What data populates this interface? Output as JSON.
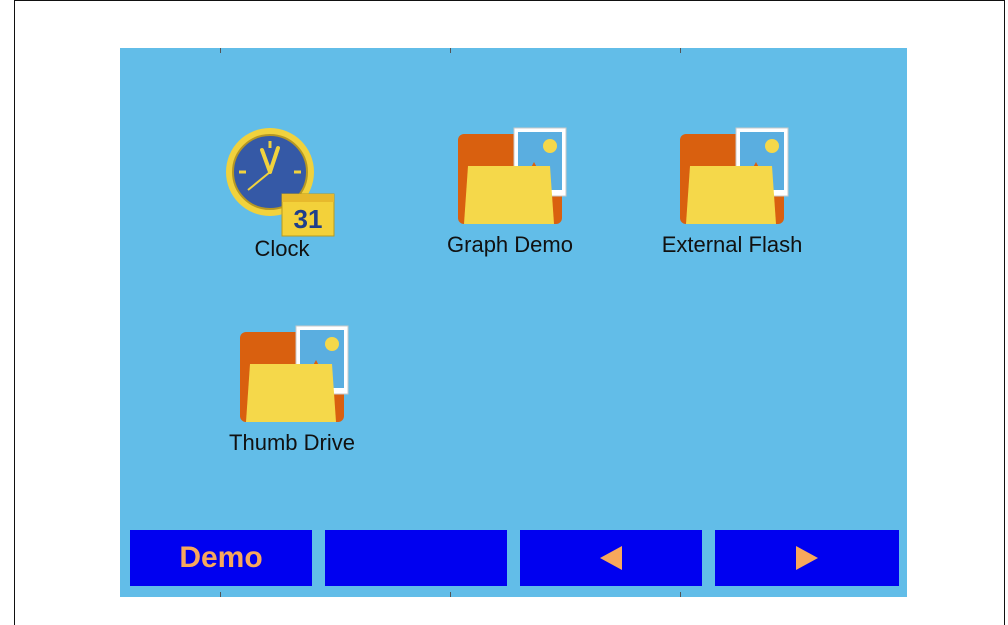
{
  "apps": [
    {
      "label": "Clock",
      "icon": "clock-calendar-icon",
      "badge": "31"
    },
    {
      "label": "Graph Demo",
      "icon": "picture-folder-icon"
    },
    {
      "label": "External Flash",
      "icon": "picture-folder-icon"
    },
    {
      "label": "Thumb Drive",
      "icon": "picture-folder-icon"
    }
  ],
  "toolbar": {
    "demo_label": "Demo",
    "prev_icon": "left-arrow-icon",
    "next_icon": "right-arrow-icon"
  },
  "colors": {
    "screen_bg": "#62bde8",
    "button_bg": "#0000f0",
    "button_text": "#f7a85c",
    "folder": "#f5d84a",
    "folder_back": "#d9600f"
  }
}
